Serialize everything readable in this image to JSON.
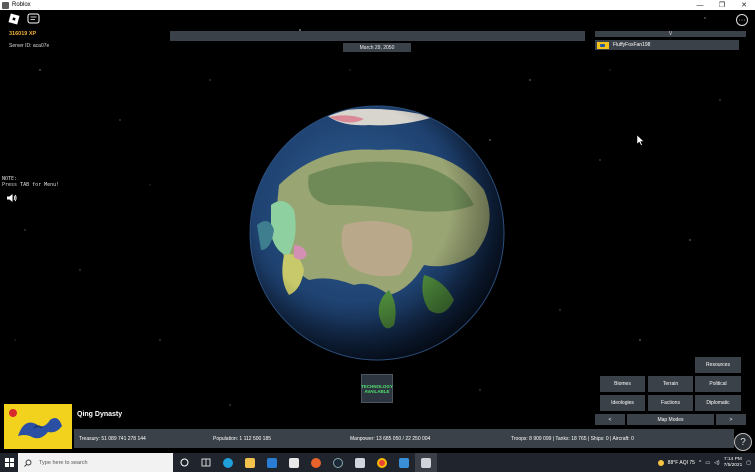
{
  "window": {
    "title": "Roblox",
    "controls": [
      "—",
      "❐",
      "✕"
    ]
  },
  "hud": {
    "xp": "316019 XP",
    "server": "Server ID: aca07e",
    "date": "March 29, 2050",
    "note": "NOTE:\nPress TAB for Menu!",
    "tech_line1": "TECHNOLOGY",
    "tech_line2": "AVAILABLE"
  },
  "playerlist": {
    "header": "V",
    "players": [
      {
        "name": "FluffyFoxFan198"
      }
    ]
  },
  "map_buttons": {
    "resources": "Resources",
    "biomes": "Biomes",
    "terrain": "Terrain",
    "political": "Political",
    "ideologies": "Ideologies",
    "factions": "Factions",
    "diplomatic": "Diplomatic",
    "prev": "<",
    "map_modes": "Map Modes",
    "next": ">"
  },
  "country": {
    "name": "Qing Dynasty"
  },
  "stats": {
    "treasury": "Treasury:  51 089 741 278 144",
    "population": "Population: 1 112 500 185",
    "manpower": "Manpower: 13 685 050  /  22 250 004",
    "military": "Troops: 8 909 099  |  Tanks: 18 765  |  Ships: 0  |  Aircraft: 0"
  },
  "taskbar": {
    "search_placeholder": "Type here to search",
    "weather": "88°F  AQI 75",
    "time": "7:14 PM",
    "date": "7/5/2021"
  },
  "colors": {
    "panel": "#3a4148",
    "xp": "#f2b13a",
    "tech_text": "#4fe36b",
    "taskbar": "#20242c"
  }
}
